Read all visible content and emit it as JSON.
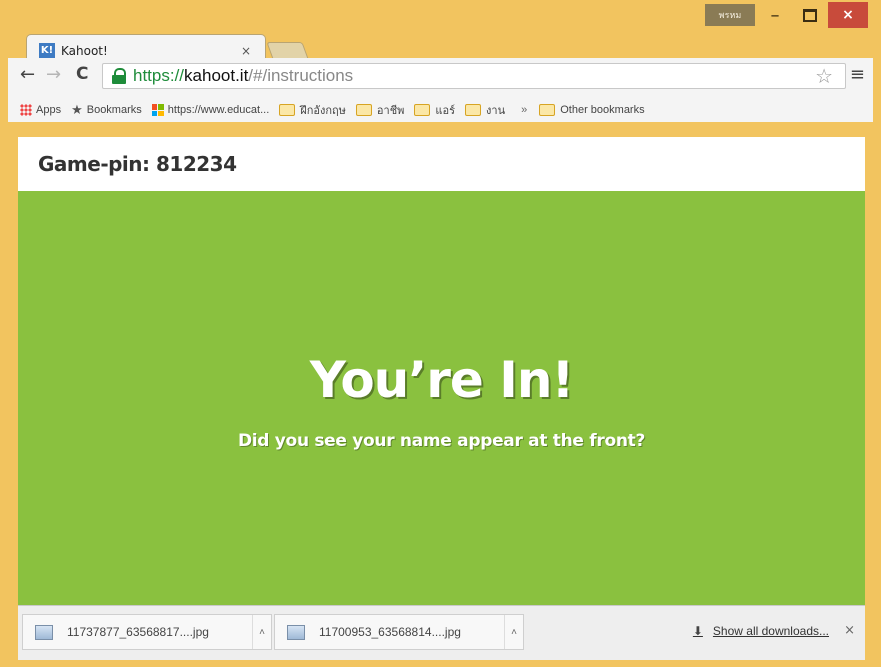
{
  "window": {
    "profile_label": "พรหม",
    "minimize_glyph": "–",
    "close_glyph": "×"
  },
  "tab": {
    "favicon_text": "K!",
    "title": "Kahoot!",
    "close_glyph": "×"
  },
  "toolbar": {
    "back_glyph": "←",
    "forward_glyph": "→",
    "reload_glyph": "C",
    "url_scheme": "https://",
    "url_host": "kahoot.it",
    "url_path": "/#/instructions",
    "star_glyph": "☆",
    "menu_glyph": "≡"
  },
  "bookmarks": {
    "items": [
      {
        "label": "Apps",
        "icon": "apps-icon"
      },
      {
        "label": "Bookmarks",
        "icon": "star-icon"
      },
      {
        "label": "https://www.educat...",
        "icon": "microsoft-icon"
      },
      {
        "label": "ฝึกอังกฤษ",
        "icon": "folder-icon"
      },
      {
        "label": "อาชีพ",
        "icon": "folder-icon"
      },
      {
        "label": "แอร์",
        "icon": "folder-icon"
      },
      {
        "label": "งาน",
        "icon": "folder-icon"
      }
    ],
    "overflow_glyph": "»",
    "other": "Other bookmarks"
  },
  "page": {
    "game_pin": "Game-pin: 812234",
    "headline": "You’re In!",
    "subline": "Did you see your name appear at the front?",
    "accent_color": "#8ac13f"
  },
  "downloads": {
    "items": [
      {
        "name": "11737877_63568817....jpg"
      },
      {
        "name": "11700953_63568814....jpg"
      }
    ],
    "dropdown_glyph": "˄",
    "show_all": "Show all downloads...",
    "close_glyph": "×"
  }
}
